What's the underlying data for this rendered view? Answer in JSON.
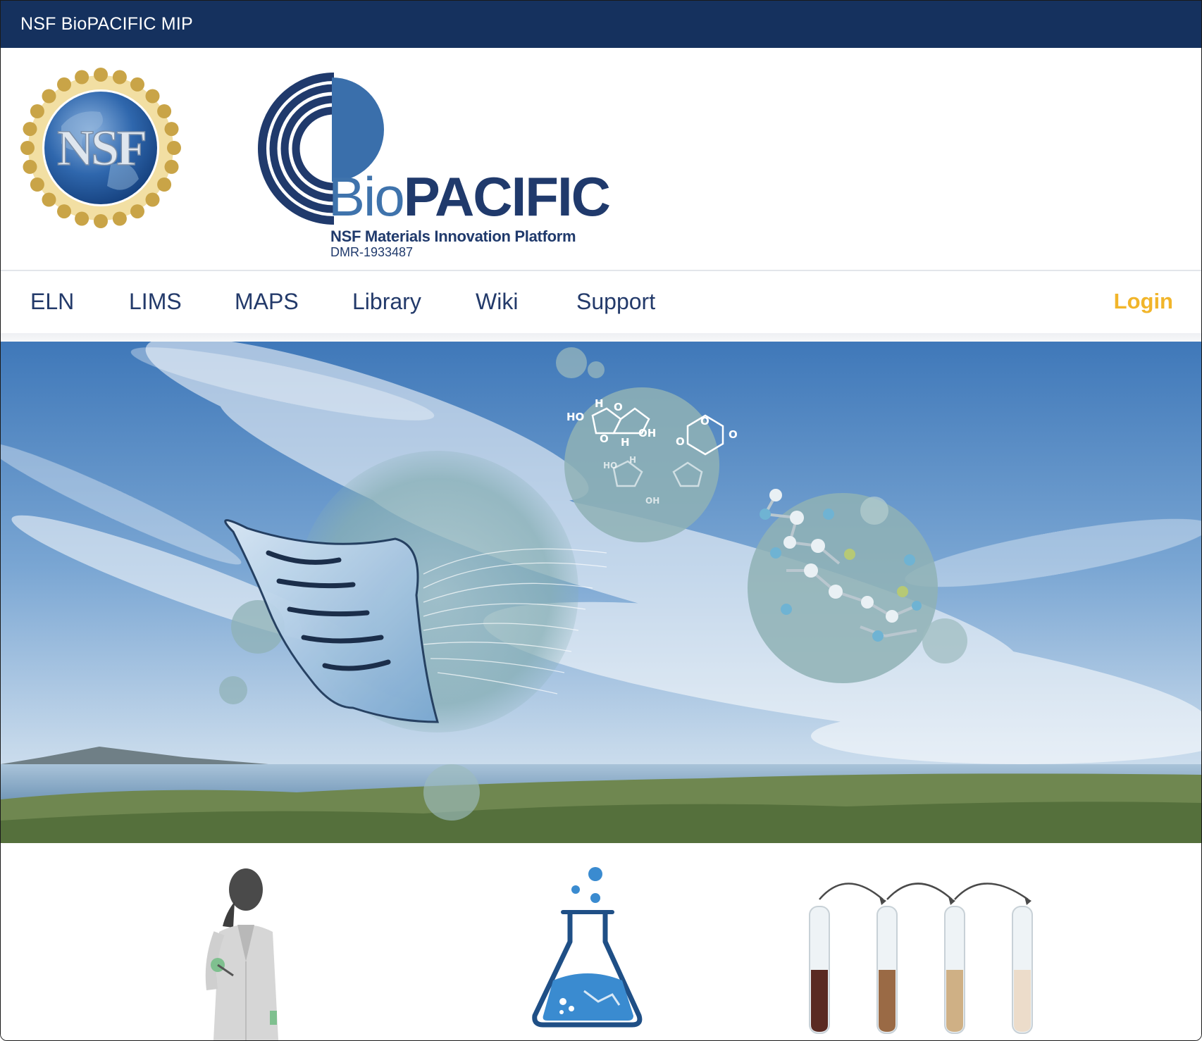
{
  "topbar": {
    "title": "NSF BioPACIFIC MIP"
  },
  "logo": {
    "nsf_text": "NSF",
    "brand_prefix": "Bio",
    "brand_suffix": "PACIFIC",
    "subtitle": "NSF Materials Innovation Platform",
    "grant": "DMR-1933487"
  },
  "nav": {
    "items": [
      {
        "label": "ELN"
      },
      {
        "label": "LIMS"
      },
      {
        "label": "MAPS"
      },
      {
        "label": "Library"
      },
      {
        "label": "Wiki"
      },
      {
        "label": "Support"
      }
    ],
    "login": "Login"
  },
  "hero": {
    "molecule_labels": [
      "HO",
      "H",
      "O",
      "OH",
      "H",
      "O",
      "O",
      "O",
      "O",
      "HO",
      "H",
      "OH"
    ]
  },
  "icons": [
    "scientist-icon",
    "flask-icon",
    "test-tubes-icon"
  ],
  "colors": {
    "topbar": "#15315e",
    "nav_text": "#233a6a",
    "login": "#f1b52a",
    "brand_dark": "#203a6c",
    "brand_light": "#3f73ac"
  }
}
